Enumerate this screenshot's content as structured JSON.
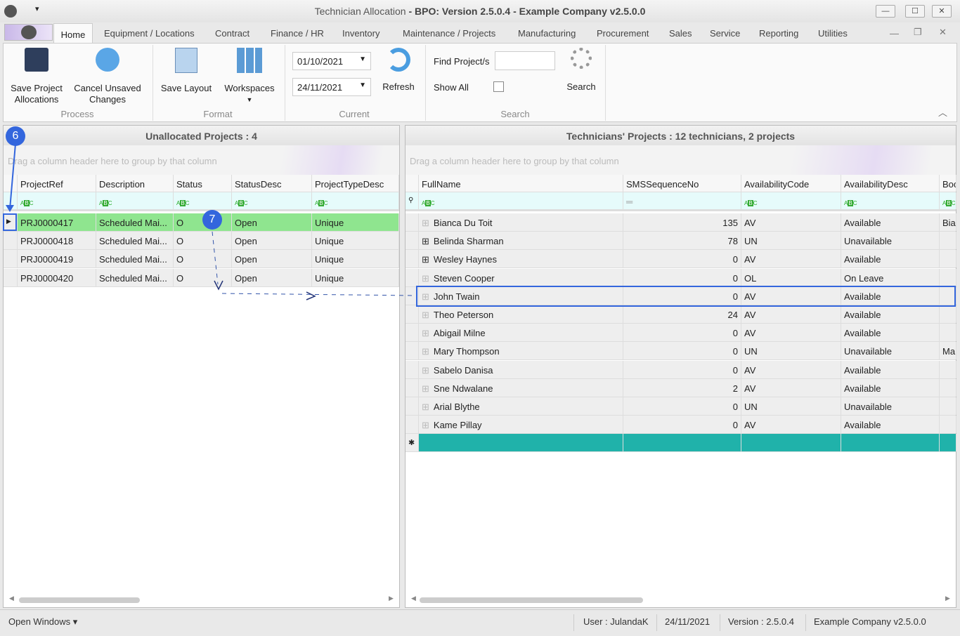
{
  "window": {
    "title_pre": "Technician Allocation",
    "title_post": " - BPO: Version 2.5.0.4 - Example Company v2.5.0.0",
    "min": "—",
    "max": "☐",
    "close": "✕"
  },
  "menu_tabs": [
    "Home",
    "Equipment / Locations",
    "Contract",
    "Finance / HR",
    "Inventory",
    "Maintenance / Projects",
    "Manufacturing",
    "Procurement",
    "Sales",
    "Service",
    "Reporting",
    "Utilities"
  ],
  "ribbon": {
    "save_project": [
      "Save Project",
      "Allocations"
    ],
    "cancel_unsaved": [
      "Cancel Unsaved",
      "Changes"
    ],
    "save_layout": "Save Layout",
    "workspaces": "Workspaces",
    "date_from": "01/10/2021",
    "date_to": "24/11/2021",
    "refresh": "Refresh",
    "find_label": "Find Project/s",
    "find_value": "",
    "show_all": "Show All",
    "show_all_checked": false,
    "search": "Search",
    "groups": [
      "Process",
      "Format",
      "Current",
      "Search"
    ]
  },
  "left": {
    "title": "Unallocated Projects : 4",
    "group_hint": "Drag a column header here to group by that column",
    "columns": [
      "ProjectRef",
      "Description",
      "Status",
      "StatusDesc",
      "ProjectTypeDesc"
    ],
    "rows": [
      [
        "PRJ0000417",
        "Scheduled Mai...",
        "O",
        "Open",
        "Unique"
      ],
      [
        "PRJ0000418",
        "Scheduled Mai...",
        "O",
        "Open",
        "Unique"
      ],
      [
        "PRJ0000419",
        "Scheduled Mai...",
        "O",
        "Open",
        "Unique"
      ],
      [
        "PRJ0000420",
        "Scheduled Mai...",
        "O",
        "Open",
        "Unique"
      ]
    ],
    "selected_row": 0,
    "selected_color": "#8fe58f"
  },
  "right": {
    "title": "Technicians' Projects : 12 technicians, 2 projects",
    "group_hint": "Drag a column header here to group by that column",
    "columns": [
      "FullName",
      "SMSSequenceNo",
      "AvailabilityCode",
      "AvailabilityDesc",
      "Boo"
    ],
    "rows": [
      [
        "Bianca Du Toit",
        "135",
        "AV",
        "Available",
        "Bia"
      ],
      [
        "Belinda Sharman",
        "78",
        "UN",
        "Unavailable",
        ""
      ],
      [
        "Wesley Haynes",
        "0",
        "AV",
        "Available",
        ""
      ],
      [
        "Steven Cooper",
        "0",
        "OL",
        "On Leave",
        ""
      ],
      [
        "John Twain",
        "0",
        "AV",
        "Available",
        ""
      ],
      [
        "Theo Peterson",
        "24",
        "AV",
        "Available",
        ""
      ],
      [
        "Abigail Milne",
        "0",
        "AV",
        "Available",
        ""
      ],
      [
        "Mary Thompson",
        "0",
        "UN",
        "Unavailable",
        "Ma"
      ],
      [
        "Sabelo Danisa",
        "0",
        "AV",
        "Available",
        ""
      ],
      [
        "Sne Ndwalane",
        "2",
        "AV",
        "Available",
        ""
      ],
      [
        "Arial Blythe",
        "0",
        "UN",
        "Unavailable",
        ""
      ],
      [
        "Kame Pillay",
        "0",
        "AV",
        "Available",
        ""
      ]
    ],
    "expanded_rows": [
      1,
      2
    ],
    "highlighted_row": 4,
    "new_row_color": "#20b2aa"
  },
  "callouts": [
    "6",
    "7"
  ],
  "status": {
    "open_windows": "Open Windows ▾",
    "user": "User : JulandaK",
    "date": "24/11/2021",
    "version": "Version : 2.5.0.4",
    "company": "Example Company v2.5.0.0"
  }
}
